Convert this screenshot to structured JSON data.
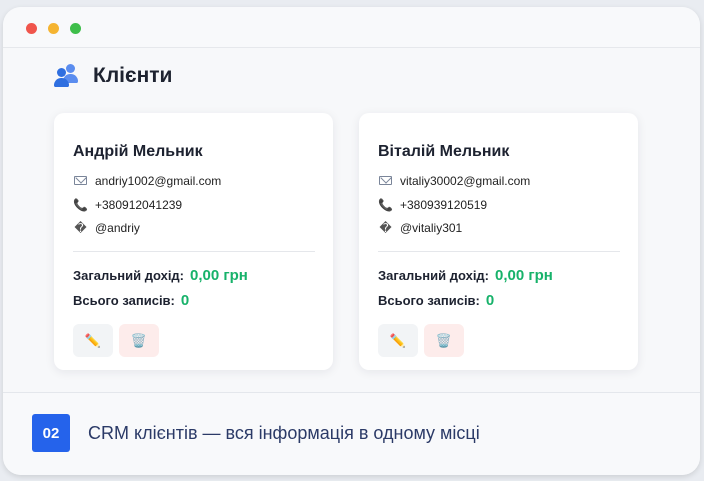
{
  "window": {
    "controls": [
      "close",
      "minimize",
      "maximize"
    ]
  },
  "header": {
    "title": "Клієнти",
    "icon": "users-icon"
  },
  "labels": {
    "income": "Загальний дохід:",
    "records": "Всього записів:"
  },
  "actions": {
    "edit_icon": "✏️",
    "delete_icon": "🗑️"
  },
  "clients": [
    {
      "name": "Андрій Мельник",
      "email": "andriy1002@gmail.com",
      "phone": "+380912041239",
      "handle": "@andriy",
      "income": "0,00 грн",
      "records": "0"
    },
    {
      "name": "Віталій Мельник",
      "email": "vitaliy30002@gmail.com",
      "phone": "+380939120519",
      "handle": "@vitaliy301",
      "income": "0,00 грн",
      "records": "0"
    }
  ],
  "footer": {
    "step": "02",
    "caption": "CRM клієнтів — вся інформація в одному місці"
  },
  "colors": {
    "accent": "#2563eb",
    "success": "#17b26a",
    "danger_bg": "#fdeceb"
  }
}
